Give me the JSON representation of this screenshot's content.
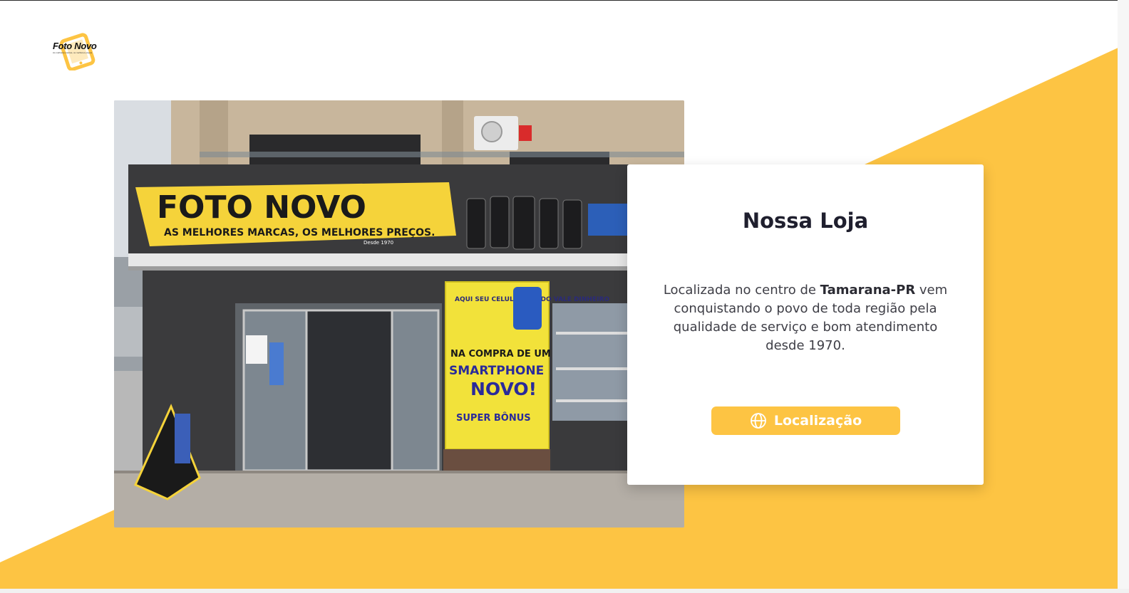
{
  "logo": {
    "name": "Foto Novo",
    "tagline": "As melhores marcas, os melhores preços"
  },
  "photo": {
    "banner_main": "FOTO NOVO",
    "banner_sub": "AS MELHORES MARCAS, OS MELHORES PREÇOS.",
    "banner_since": "Desde 1970",
    "poster_1": "AQUI SEU CELULAR USADO VALE DINHEIRO",
    "poster_2": "NA COMPRA DE UM",
    "poster_3": "SMARTPHONE",
    "poster_4": "NOVO!",
    "poster_5": "SUPER BÔNUS"
  },
  "card": {
    "title": "Nossa Loja",
    "text_before": "Localizada no centro de ",
    "text_bold": "Tamarana-PR",
    "text_after": " vem conquistando o povo de toda região pela qualidade de serviço e bom atendimento desde 1970.",
    "button_label": "Localização",
    "button_icon": "globe-icon"
  },
  "colors": {
    "accent": "#fdc443",
    "title": "#1f1f2e",
    "text": "#3e3e46"
  }
}
